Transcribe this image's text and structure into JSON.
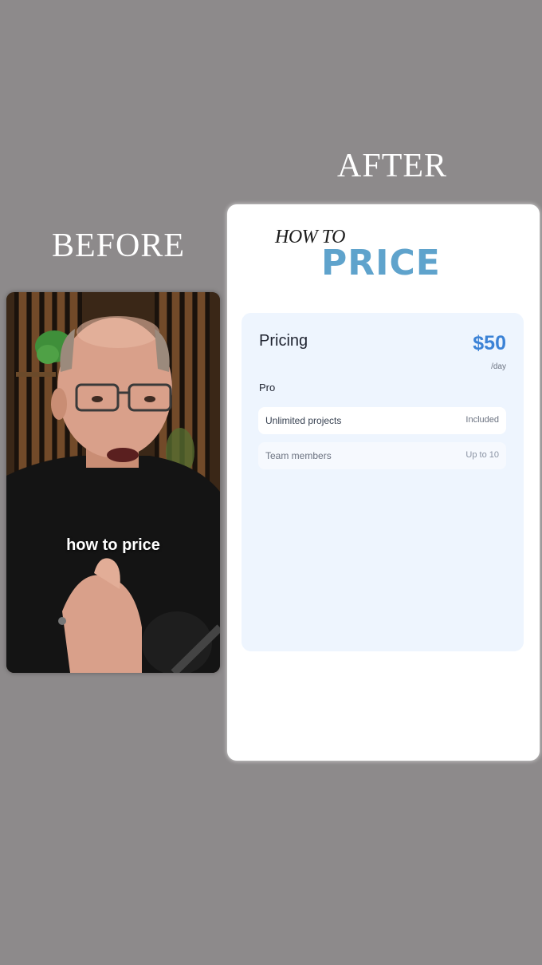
{
  "labels": {
    "before": "BEFORE",
    "after": "AFTER"
  },
  "video": {
    "caption": "how to price"
  },
  "after_card": {
    "headline_small": "HOW TO",
    "headline_large": "PRICE",
    "panel": {
      "title": "Pricing",
      "price": "$50",
      "period": "/day",
      "plan": "Pro",
      "features": [
        {
          "name": "Unlimited projects",
          "value": "Included"
        },
        {
          "name": "Team members",
          "value": "Up to 10"
        }
      ]
    }
  },
  "colors": {
    "background": "#8d8a8b",
    "accent_blue": "#3b82d6",
    "headline_blue": "#5fa3cc",
    "panel_bg": "#eef5fe"
  }
}
